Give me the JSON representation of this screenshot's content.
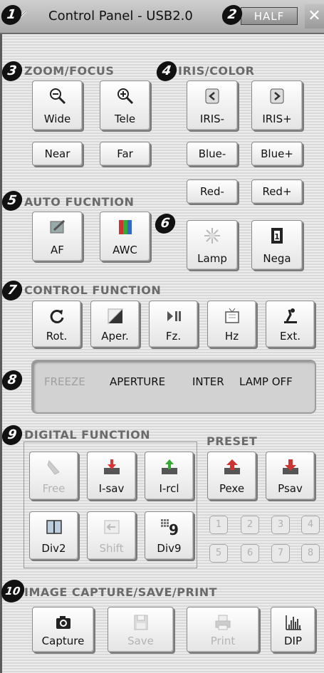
{
  "window": {
    "title": "Control Panel - USB2.0",
    "half_label": "HALF",
    "close_label": "✕"
  },
  "callouts": [
    "1",
    "2",
    "3",
    "4",
    "5",
    "6",
    "7",
    "8",
    "9",
    "10"
  ],
  "sections": {
    "zoom_focus": "ZOOM/FOCUS",
    "iris_color": "IRIS/COLOR",
    "auto_function": "AUTO FUCNTION",
    "control_function": "CONTROL FUNCTION",
    "digital_function": "DIGITAL FUNCTION",
    "preset": "PRESET",
    "image_capture": "IMAGE CAPTURE/SAVE/PRINT"
  },
  "zoom_focus": {
    "wide": "Wide",
    "tele": "Tele",
    "near": "Near",
    "far": "Far"
  },
  "iris_color": {
    "iris_minus": "IRIS-",
    "iris_plus": "IRIS+",
    "blue_minus": "Blue-",
    "blue_plus": "Blue+",
    "red_minus": "Red-",
    "red_plus": "Red+"
  },
  "auto_function": {
    "af": "AF",
    "awc": "AWC",
    "lamp": "Lamp",
    "nega": "Nega"
  },
  "control_function": {
    "rot": "Rot.",
    "aper": "Aper.",
    "fz": "Fz.",
    "hz": "Hz",
    "ext": "Ext."
  },
  "status": {
    "freeze": "FREEZE",
    "aperture": "APERTURE",
    "inter": "INTER",
    "lamp_off": "LAMP OFF"
  },
  "digital_function": {
    "free": "Free",
    "i_sav": "I-sav",
    "i_rcl": "I-rcl",
    "div2": "Div2",
    "shift": "Shift",
    "div9": "Div9"
  },
  "preset": {
    "pexe": "Pexe",
    "psav": "Psav",
    "numbers": [
      "1",
      "2",
      "3",
      "4",
      "5",
      "6",
      "7",
      "8"
    ]
  },
  "image_capture": {
    "capture": "Capture",
    "save": "Save",
    "print": "Print",
    "dip": "DIP"
  },
  "colors": {
    "header_text": "#6a6a6a",
    "callout_bg": "#111111",
    "button_face": "#f4f4f4",
    "disabled_text": "#b4b4b4"
  }
}
